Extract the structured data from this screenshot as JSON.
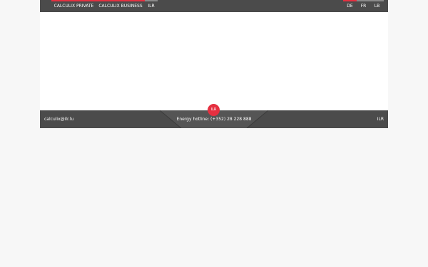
{
  "colors": {
    "brand_red": "#e53040",
    "bar_grey": "#4b4b4b",
    "nav_accent_light": "#8a8a8a"
  },
  "header": {
    "nav": [
      {
        "label": "CALCULIX PRIVATE"
      },
      {
        "label": "CALCULIX BUSINESS"
      },
      {
        "label": "ILR"
      }
    ],
    "languages": [
      {
        "label": "DE"
      },
      {
        "label": "FR"
      },
      {
        "label": "LB"
      }
    ]
  },
  "footer": {
    "email": "calculix@ilr.lu",
    "badge": "ILR",
    "hotline": "Energy hotline: (+352) 28 228 888",
    "right_label": "ILR"
  }
}
